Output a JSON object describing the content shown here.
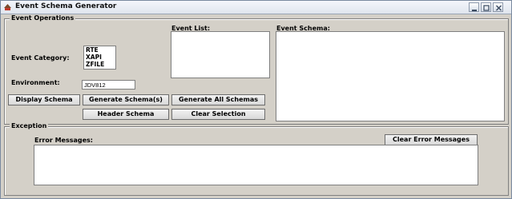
{
  "window": {
    "title": "Event Schema Generator",
    "controls": [
      "minimize",
      "maximize",
      "close"
    ]
  },
  "event_operations": {
    "legend": "Event Operations",
    "event_category_label": "Event Category:",
    "event_categories": [
      "RTE",
      "XAPI",
      "ZFILE"
    ],
    "environment_label": "Environment:",
    "environment_value": "JDV812",
    "event_list_label": "Event List:",
    "event_schema_label": "Event Schema:",
    "buttons": {
      "display_schema": "Display Schema",
      "generate_schemas": "Generate Schema(s)",
      "generate_all_schemas": "Generate All Schemas",
      "header_schema": "Header Schema",
      "clear_selection": "Clear Selection"
    }
  },
  "exception": {
    "legend": "Exception",
    "error_messages_label": "Error Messages:",
    "clear_error_messages": "Clear Error Messages"
  }
}
